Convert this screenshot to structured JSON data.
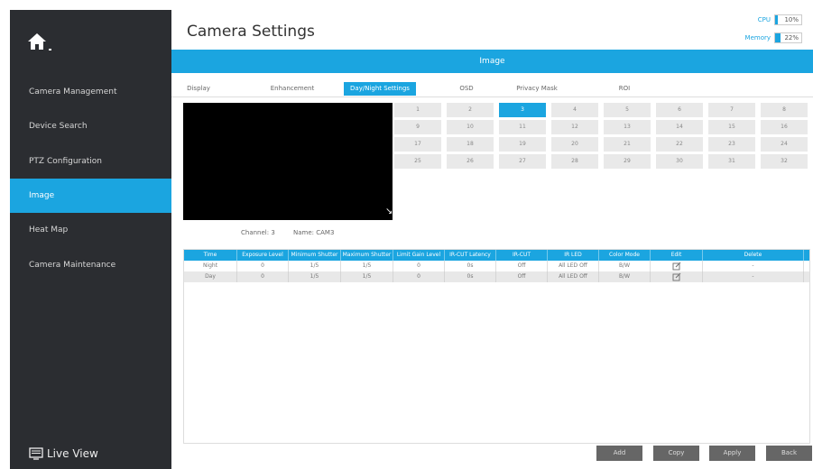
{
  "header": {
    "title": "Camera Settings"
  },
  "stats": {
    "cpu_label": "CPU",
    "cpu_value": "10%",
    "cpu_level": 10,
    "mem_label": "Memory",
    "mem_value": "22%",
    "mem_level": 22
  },
  "sidebar": {
    "items": [
      {
        "label": "Camera Management"
      },
      {
        "label": "Device Search"
      },
      {
        "label": "PTZ Configuration"
      },
      {
        "label": "Image"
      },
      {
        "label": "Heat Map"
      },
      {
        "label": "Camera Maintenance"
      }
    ],
    "live_view": "Live View"
  },
  "banner": "Image",
  "tabs": [
    "Display",
    "Enhancement",
    "Day/Night Settings",
    "OSD",
    "Privacy Mask",
    "ROI"
  ],
  "channels": [
    "1",
    "2",
    "3",
    "4",
    "5",
    "6",
    "7",
    "8",
    "9",
    "10",
    "11",
    "12",
    "13",
    "14",
    "15",
    "16",
    "17",
    "18",
    "19",
    "20",
    "21",
    "22",
    "23",
    "24",
    "25",
    "26",
    "27",
    "28",
    "29",
    "30",
    "31",
    "32"
  ],
  "channel_info": {
    "channel": "Channel: 3",
    "name": "Name: CAM3"
  },
  "table": {
    "headers": [
      "Time",
      "Exposure Level",
      "Minimum Shutter",
      "Maximum Shutter",
      "Limit Gain Level",
      "IR-CUT Latency",
      "IR-CUT",
      "IR LED",
      "Color Mode",
      "Edit",
      "Delete"
    ],
    "rows": [
      [
        "Night",
        "0",
        "1/5",
        "1/5",
        "0",
        "0s",
        "Off",
        "All LED Off",
        "B/W",
        "",
        "-"
      ],
      [
        "Day",
        "0",
        "1/5",
        "1/5",
        "0",
        "0s",
        "Off",
        "All LED Off",
        "B/W",
        "",
        "-"
      ]
    ]
  },
  "buttons": {
    "add": "Add",
    "copy": "Copy",
    "apply": "Apply",
    "back": "Back"
  },
  "colors": {
    "accent": "#1ba5e0",
    "sidebar_bg": "#2b2d31",
    "button_bg": "#666666"
  }
}
